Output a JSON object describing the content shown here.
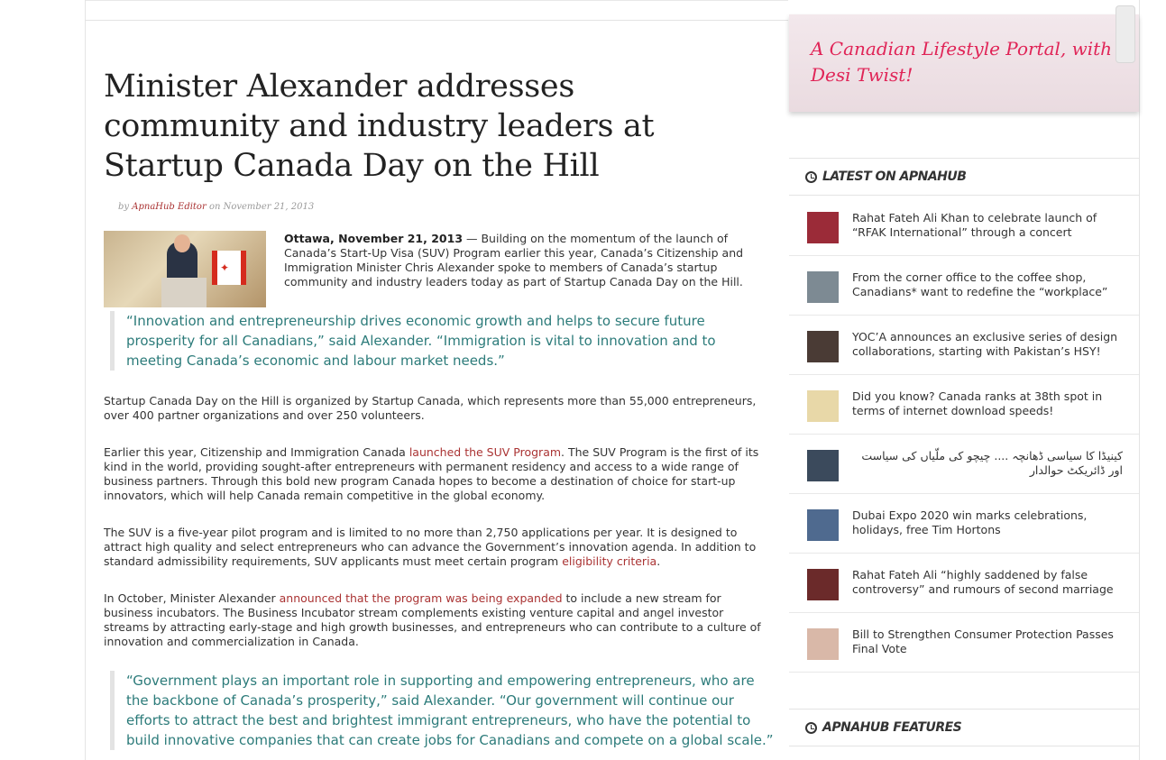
{
  "article": {
    "title": "Minister Alexander addresses community and industry leaders at Startup Canada Day on the Hill",
    "byline_prefix": "by",
    "author": "ApnaHub Editor",
    "byline_on": "on",
    "date": "November 21, 2013",
    "lead_dateline": "Ottawa, November 21, 2013",
    "lead_text": " — Building on the momentum of the launch of Canada’s Start-Up Visa (SUV) Program earlier this year, Canada’s Citizenship and Immigration Minister Chris Alexander spoke to members of Canada’s startup community and industry leaders today as part of Startup Canada Day on the Hill.",
    "quote1": "“Innovation and entrepreneurship drives economic growth and helps to secure future prosperity for all Canadians,” said Alexander. “Immigration is vital to innovation and to meeting Canada’s economic and labour market needs.”",
    "para1": "Startup Canada Day on the Hill is organized by Startup Canada, which represents more than 55,000 entrepreneurs, over 400 partner organizations and over 250 volunteers.",
    "para2_a": "Earlier this year, Citizenship and Immigration Canada ",
    "para2_link": "launched the SUV Program",
    "para2_b": ". The SUV Program is the first of its kind in the world, providing sought-after entrepreneurs with permanent residency and access to a wide range of business partners. Through this bold new program Canada hopes to become a destination of choice for start-up innovators, which will help Canada remain competitive in the global economy.",
    "para3_a": "The SUV is a five-year pilot program and is limited to no more than 2,750 applications per year. It is designed to attract high quality and select entrepreneurs who can advance the Government’s innovation agenda. In addition to standard admissibility requirements, SUV applicants must meet certain program ",
    "para3_link": "eligibility criteria",
    "para3_b": ".",
    "para4_a": "In October, Minister Alexander ",
    "para4_link": "announced that the program was being expanded",
    "para4_b": " to include a new stream for business incubators. The Business Incubator stream complements existing venture capital and angel investor streams by attracting early-stage and high growth businesses, and entrepreneurs who can contribute to a culture of innovation and commercialization in Canada.",
    "quote2": "“Government plays an important role in supporting and empowering entrepreneurs, who are the backbone of Canada’s prosperity,” said Alexander. “Our government will continue our efforts to attract the best and brightest immigrant entrepreneurs, who have the potential to build innovative companies that can create jobs for Canadians and compete on a global scale.”"
  },
  "sidebar": {
    "banner": "A Canadian Lifestyle Portal, with a Desi Twist!",
    "latest_heading": "LATEST ON APNAHUB",
    "features_heading": "APNAHUB FEATURES",
    "items": [
      {
        "title": "Rahat Fateh Ali Khan to celebrate launch of “RFAK International” through a concert",
        "thumb": "#9b2b38"
      },
      {
        "title": "From the corner office to the coffee shop, Canadians* want to redefine the “workplace”",
        "thumb": "#7d8a93"
      },
      {
        "title": "YOC’A announces an exclusive series of design collaborations, starting with Pakistan’s HSY!",
        "thumb": "#4a3b35"
      },
      {
        "title": "Did you know? Canada ranks at 38th spot in terms of internet download speeds!",
        "thumb": "#e8d8a8"
      },
      {
        "title": "کینیڈا کا سیاسی ڈھانچہ .... چیچو کی ملّیاں کی سیاست اور ڈائریکٹ حوالدار",
        "thumb": "#3b4a5c"
      },
      {
        "title": "Dubai Expo 2020 win marks celebrations, holidays, free Tim Hortons",
        "thumb": "#4f6a8f"
      },
      {
        "title": "Rahat Fateh Ali “highly saddened by false controversy” and rumours of second marriage",
        "thumb": "#6b2a2a"
      },
      {
        "title": "Bill to Strengthen Consumer Protection Passes Final Vote",
        "thumb": "#d9b8a8"
      }
    ]
  }
}
